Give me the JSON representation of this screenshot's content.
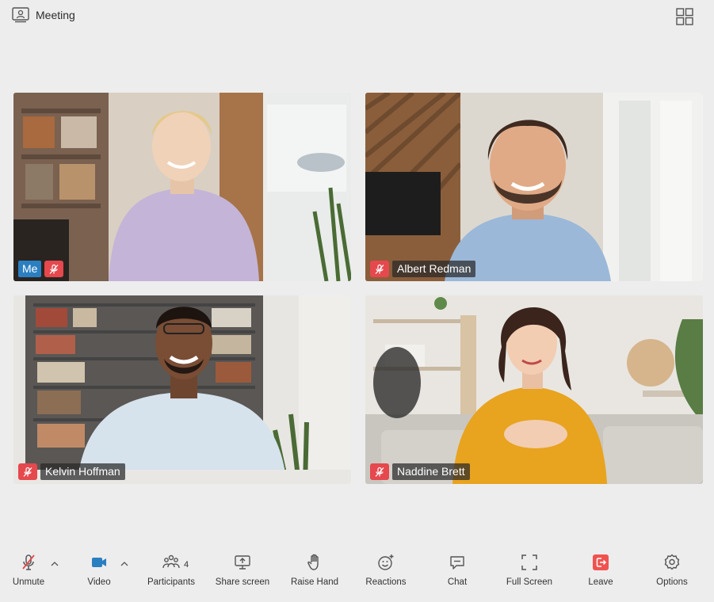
{
  "header": {
    "title": "Meeting",
    "title_icon": "presenter-icon",
    "layout_icon": "grid-layout-icon"
  },
  "participants": [
    {
      "name": "Me",
      "is_self": true,
      "muted": true
    },
    {
      "name": "Albert Redman",
      "is_self": false,
      "muted": true
    },
    {
      "name": "Kelvin Hoffman",
      "is_self": false,
      "muted": true
    },
    {
      "name": "Naddine Brett",
      "is_self": false,
      "muted": true
    }
  ],
  "toolbar": {
    "unmute": "Unmute",
    "video": "Video",
    "participants": "Participants",
    "participants_count": "4",
    "share_screen": "Share screen",
    "raise_hand": "Raise Hand",
    "reactions": "Reactions",
    "chat": "Chat",
    "full_screen": "Full Screen",
    "leave": "Leave",
    "options": "Options"
  },
  "colors": {
    "accent": "#2a7fc1",
    "muted_red": "#e5484d",
    "leave_red": "#ef5350",
    "background": "#ededed"
  }
}
